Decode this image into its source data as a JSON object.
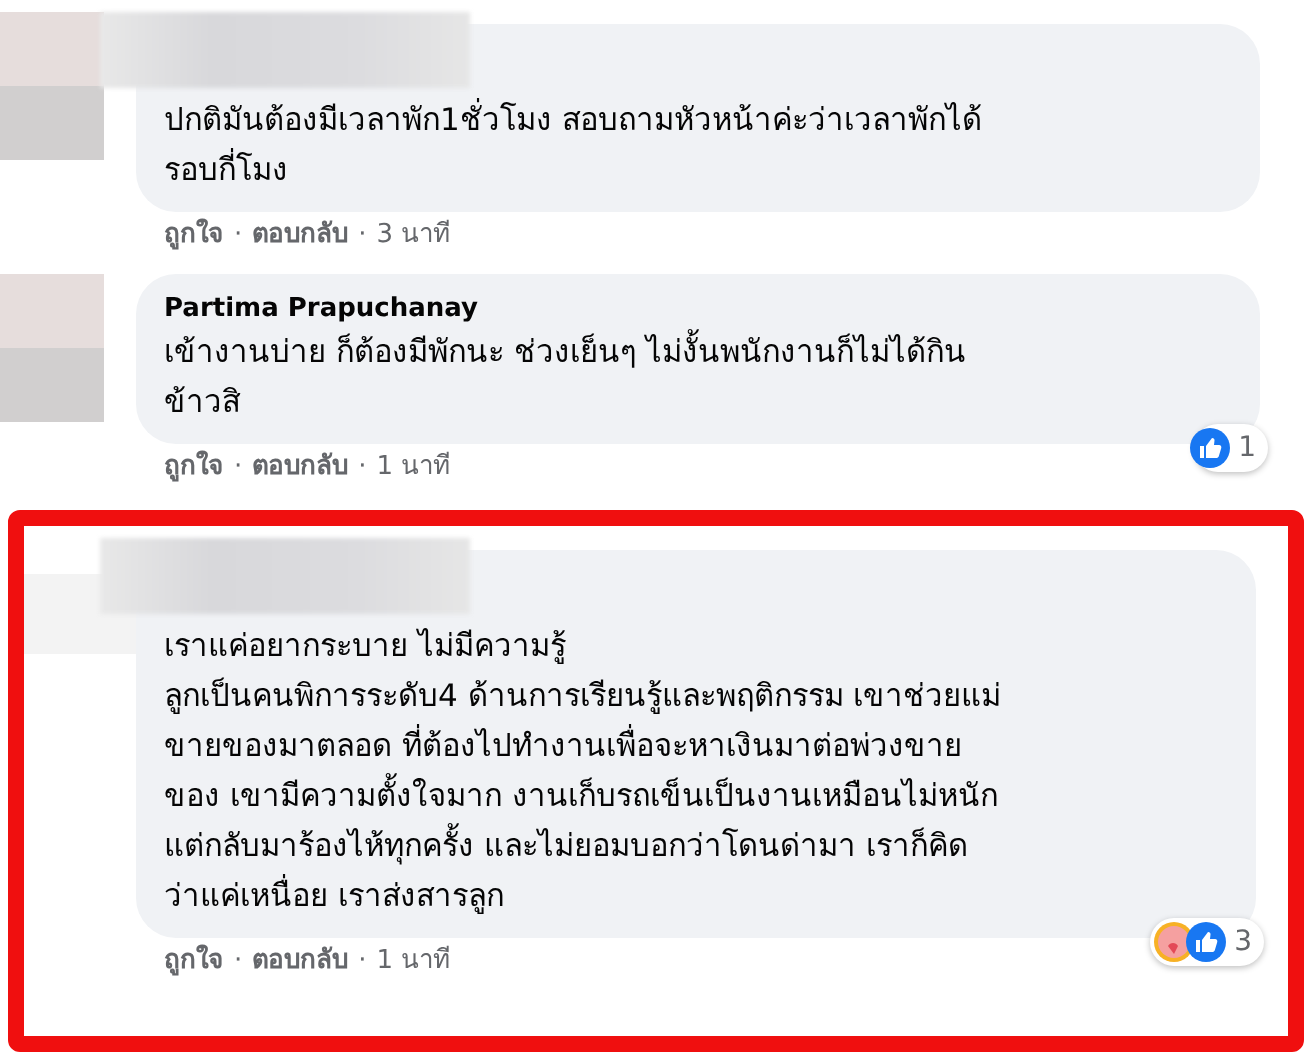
{
  "comments": [
    {
      "lines": [
        "ปกติมันต้องมีเวลาพัก1ชั่วโมง สอบถามหัวหน้าค่ะว่าเวลาพักได้",
        "รอบกี่โมง"
      ],
      "actions": [
        {
          "kind": "link",
          "text": "ถูกใจ"
        },
        {
          "kind": "dot",
          "text": "·"
        },
        {
          "kind": "link",
          "text": "ตอบกลับ"
        },
        {
          "kind": "dot",
          "text": "·"
        },
        {
          "kind": "time",
          "text": "3 นาที"
        }
      ],
      "highlighted": false
    },
    {
      "author": "Partima Prapuchanay",
      "lines": [
        "เข้างานบ่าย ก็ต้องมีพักนะ ช่วงเย็นๆ ไม่งั้นพนักงานก็ไม่ได้กิน",
        "ข้าวสิ"
      ],
      "actions": [
        {
          "kind": "link",
          "text": "ถูกใจ"
        },
        {
          "kind": "dot",
          "text": "·"
        },
        {
          "kind": "link",
          "text": "ตอบกลับ"
        },
        {
          "kind": "dot",
          "text": "·"
        },
        {
          "kind": "time",
          "text": "1 นาที"
        }
      ],
      "reactions": [
        {
          "kind": "like"
        }
      ],
      "reaction_count": "1",
      "highlighted": false
    },
    {
      "lines": [
        "เราแค่อยากระบาย ไม่มีความรู้",
        "ลูกเป็นคนพิการระดับ4 ด้านการเรียนรู้และพฤติกรรม เขาช่วยแม่",
        "ขายของมาตลอด ที่ต้องไปทำงานเพื่อจะหาเงินมาต่อพ่วงขาย",
        "ของ เขามีความตั้งใจมาก งานเก็บรถเข็นเป็นงานเหมือนไม่หนัก",
        "แต่กลับมาร้องไห้ทุกครั้ง และไม่ยอมบอกว่าโดนด่ามา เราก็คิด",
        "ว่าแค่เหนื่อย เราส่งสารลูก"
      ],
      "actions": [
        {
          "kind": "link",
          "text": "ถูกใจ"
        },
        {
          "kind": "dot",
          "text": "·"
        },
        {
          "kind": "link",
          "text": "ตอบกลับ"
        },
        {
          "kind": "dot",
          "text": "·"
        },
        {
          "kind": "time",
          "text": "1 นาที"
        }
      ],
      "reactions": [
        {
          "kind": "care"
        },
        {
          "kind": "like"
        }
      ],
      "reaction_count": "3",
      "highlighted": true
    }
  ]
}
